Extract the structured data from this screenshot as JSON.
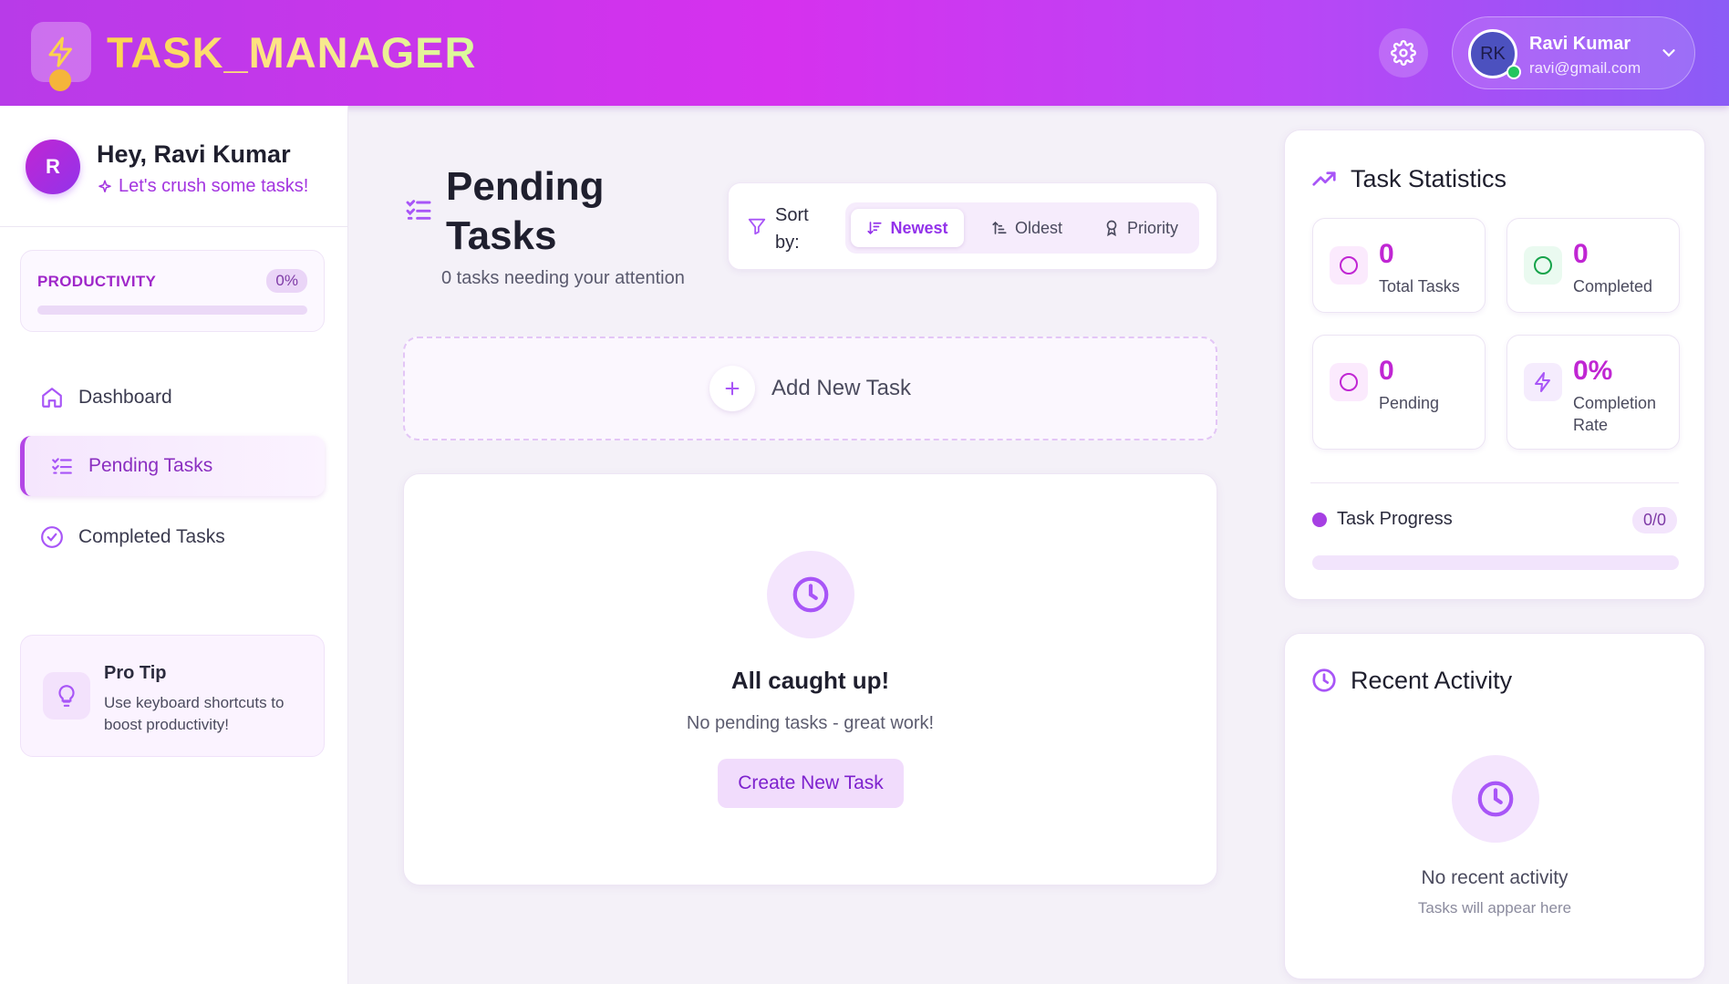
{
  "header": {
    "app_title": "TASK_MANAGER",
    "user": {
      "initials": "RK",
      "name": "Ravi Kumar",
      "email": "ravi@gmail.com"
    },
    "icons": {
      "logo": "lightning-icon",
      "settings": "gear-icon",
      "dropdown": "chevron-down-icon"
    }
  },
  "sidebar": {
    "avatar_initial": "R",
    "greeting": "Hey, Ravi Kumar",
    "tagline": "Let's crush some tasks!",
    "productivity": {
      "label": "PRODUCTIVITY",
      "value_text": "0%",
      "progress_percent": 0
    },
    "nav": [
      {
        "label": "Dashboard",
        "icon": "home-icon",
        "active": false
      },
      {
        "label": "Pending Tasks",
        "icon": "list-check-icon",
        "active": true
      },
      {
        "label": "Completed Tasks",
        "icon": "check-circle-icon",
        "active": false
      }
    ],
    "tip": {
      "title": "Pro Tip",
      "text": "Use keyboard shortcuts to boost productivity!",
      "icon": "lightbulb-icon"
    }
  },
  "main": {
    "title": "Pending Tasks",
    "subtitle": "0 tasks needing your attention",
    "sort": {
      "label": "Sort by:",
      "options": [
        {
          "label": "Newest",
          "icon": "sort-desc-icon",
          "active": true
        },
        {
          "label": "Oldest",
          "icon": "sort-asc-icon",
          "active": false
        },
        {
          "label": "Priority",
          "icon": "award-icon",
          "active": false
        }
      ]
    },
    "add_task_label": "Add New Task",
    "empty": {
      "title": "All caught up!",
      "subtitle": "No pending tasks - great work!",
      "button": "Create New Task"
    }
  },
  "stats": {
    "title": "Task Statistics",
    "items": [
      {
        "value": "0",
        "label": "Total Tasks",
        "icon": "circle-icon",
        "color": "#c026d3"
      },
      {
        "value": "0",
        "label": "Completed",
        "icon": "circle-icon",
        "color": "#16a34a"
      },
      {
        "value": "0",
        "label": "Pending",
        "icon": "circle-icon",
        "color": "#c026d3"
      },
      {
        "value": "0%",
        "label": "Completion Rate",
        "icon": "lightning-icon",
        "color": "#a855f7"
      }
    ],
    "progress": {
      "label": "Task Progress",
      "count": "0/0",
      "progress_percent": 0
    }
  },
  "activity": {
    "title": "Recent Activity",
    "empty_title": "No recent activity",
    "empty_sub": "Tasks will appear here"
  },
  "colors": {
    "accent": "#a855f7",
    "brand_pink": "#c026d3",
    "online": "#22c55e"
  }
}
